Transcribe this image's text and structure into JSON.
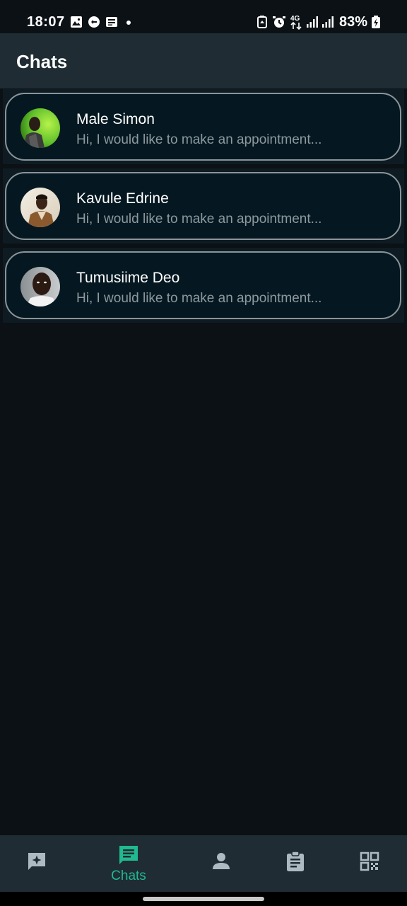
{
  "status_bar": {
    "time": "18:07",
    "battery_percent": "83%",
    "network_type": "4G",
    "icons": [
      "gallery-icon",
      "app-notification-icon",
      "message-notification-icon",
      "dot-icon",
      "battery-saver-icon",
      "alarm-icon",
      "network-4g-icon",
      "signal-icon",
      "signal-icon",
      "battery-charging-icon"
    ]
  },
  "app_bar": {
    "title": "Chats"
  },
  "chats": [
    {
      "name": "Male Simon",
      "preview": "Hi, I would like to make an appointment...",
      "avatar": "avatar-photo"
    },
    {
      "name": "Kavule Edrine",
      "preview": "Hi, I would like to make an appointment...",
      "avatar": "avatar-photo"
    },
    {
      "name": "Tumusiime Deo",
      "preview": "Hi, I would like to make an appointment...",
      "avatar": "avatar-photo"
    }
  ],
  "bottom_nav": {
    "items": [
      {
        "icon": "ai-chat-icon",
        "label": "",
        "active": false
      },
      {
        "icon": "chat-icon",
        "label": "Chats",
        "active": true
      },
      {
        "icon": "person-icon",
        "label": "",
        "active": false
      },
      {
        "icon": "clipboard-icon",
        "label": "",
        "active": false
      },
      {
        "icon": "qr-code-icon",
        "label": "",
        "active": false
      }
    ]
  },
  "colors": {
    "background": "#0b1115",
    "app_bar": "#1f2c33",
    "card": "#051821",
    "card_border": "#8a9499",
    "accent": "#20b990",
    "nav_icon": "#aebac1",
    "secondary_text": "#8d999f"
  }
}
